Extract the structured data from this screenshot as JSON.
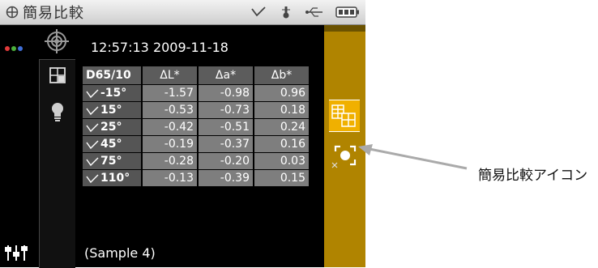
{
  "title_bar": {
    "title": "簡易比較"
  },
  "measurement": {
    "datetime": "12:57:13 2009-11-18",
    "sample": "(Sample 4)"
  },
  "table": {
    "headers": [
      "D65/10",
      "ΔL*",
      "Δa*",
      "Δb*"
    ],
    "rows": [
      {
        "angle": "-15°",
        "dL": "-1.57",
        "da": "-0.98",
        "db": "0.96"
      },
      {
        "angle": "15°",
        "dL": "-0.53",
        "da": "-0.73",
        "db": "0.18"
      },
      {
        "angle": "25°",
        "dL": "-0.42",
        "da": "-0.51",
        "db": "0.24"
      },
      {
        "angle": "45°",
        "dL": "-0.19",
        "da": "-0.37",
        "db": "0.16"
      },
      {
        "angle": "75°",
        "dL": "-0.28",
        "da": "-0.20",
        "db": "0.03"
      },
      {
        "angle": "110°",
        "dL": "-0.13",
        "da": "-0.39",
        "db": "0.15"
      }
    ]
  },
  "annotation": {
    "callout_label": "簡易比較アイコン"
  },
  "icons": {
    "title": "compare-icon",
    "status": [
      "measure-angle-icon",
      "temperature-icon",
      "usb-icon",
      "battery-icon"
    ],
    "left": [
      "color-dots-icon",
      "target-icon",
      "grid-icon",
      "lightbulb-icon",
      "sliders-icon"
    ],
    "right": [
      "table-view-icon",
      "quick-compare-icon"
    ]
  },
  "colors": {
    "accent_panel": "#b08400",
    "highlight": "#f0b000",
    "cell": "#7e7e7e",
    "header": "#5c5c5c"
  }
}
